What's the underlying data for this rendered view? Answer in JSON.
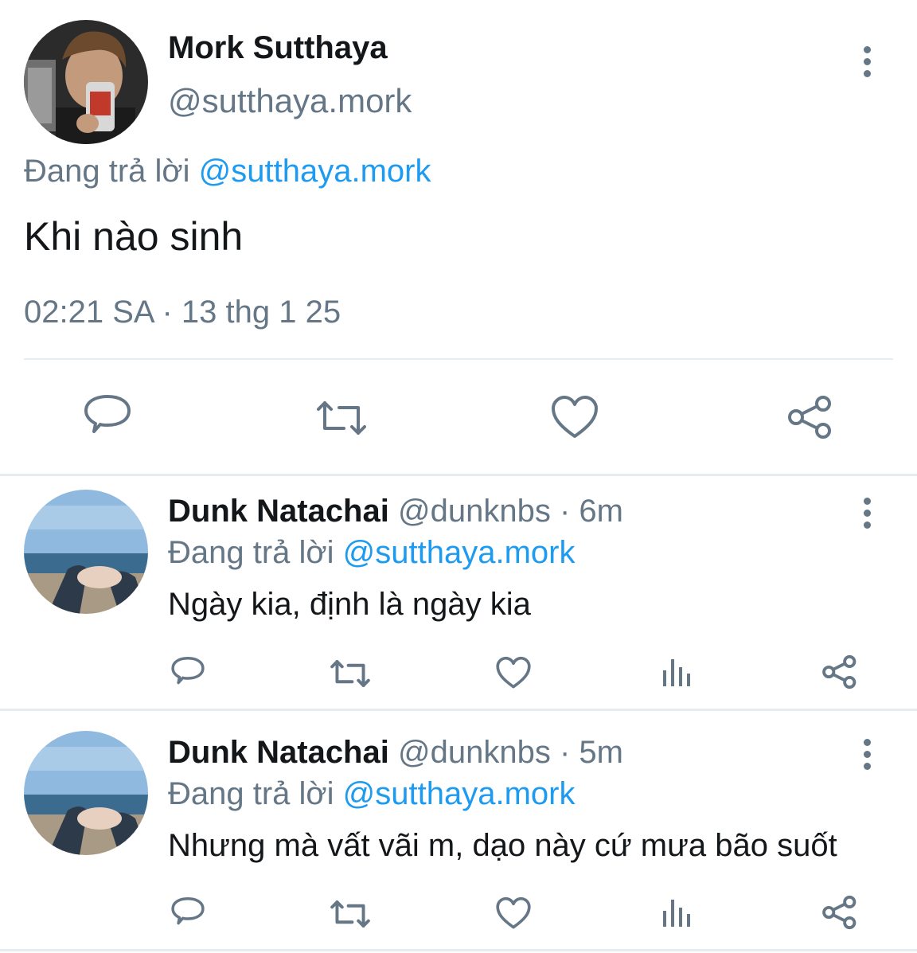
{
  "main_tweet": {
    "author_name": "Mork Sutthaya",
    "author_handle": "@sutthaya.mork",
    "replying_prefix": "Đang trả lời",
    "replying_to": "@sutthaya.mork",
    "text": "Khi nào sinh",
    "timestamp": "02:21 SA · 13 thg 1 25",
    "actions": [
      "reply-icon",
      "retweet-icon",
      "like-icon",
      "share-icon"
    ]
  },
  "replies": [
    {
      "author_name": "Dunk Natachai",
      "author_handle": "@dunknbs",
      "time_ago": "· 6m",
      "replying_prefix": "Đang trả lời",
      "replying_to": "@sutthaya.mork",
      "text": "Ngày kia, định là ngày kia"
    },
    {
      "author_name": "Dunk Natachai",
      "author_handle": "@dunknbs",
      "time_ago": "· 5m",
      "replying_prefix": "Đang trả lời",
      "replying_to": "@sutthaya.mork",
      "text": "Nhưng mà vất vãi m, dạo này cứ mưa bão suốt"
    }
  ],
  "colors": {
    "accent_link": "#1d9bf0",
    "muted_text": "#657786",
    "divider": "#e6ecf0"
  }
}
